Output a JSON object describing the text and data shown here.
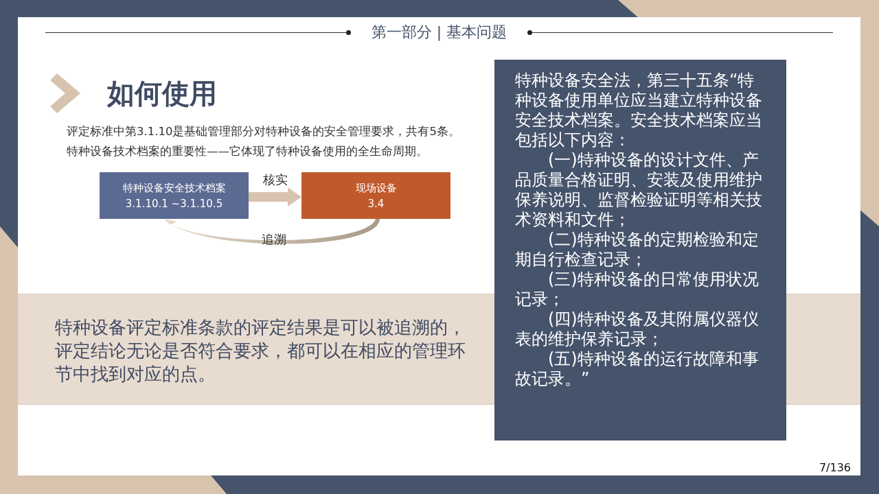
{
  "header": {
    "title": "第一部分 | 基本问题"
  },
  "heading": "如何使用",
  "intro_lines": [
    "评定标准中第3.1.10是基础管理部分对特种设备的安全管理要求，共有5条。",
    "特种设备技术档案的重要性——它体现了特种设备使用的全生命周期。"
  ],
  "diagram": {
    "source": {
      "title": "特种设备安全技术档案",
      "code": "3.1.10.1 ~3.1.10.5"
    },
    "target": {
      "title": "现场设备",
      "code": "3.4"
    },
    "forward_label": "核实",
    "back_label": "追溯"
  },
  "summary": "特种设备评定标准条款的评定结果是可以被追溯的，评定结论无论是否符合要求，都可以在相应的管理环节中找到对应的点。",
  "panel": {
    "lead": "特种设备安全法，第三十五条“特种设备使用单位应当建立特种设备安全技术档案。安全技术档案应当包括以下内容：",
    "items": [
      "(一)特种设备的设计文件、产品质量合格证明、安装及使用维护保养说明、监督检验证明等相关技术资料和文件；",
      "(二)特种设备的定期检验和定期自行检查记录；",
      "(三)特种设备的日常使用状况记录；",
      "(四)特种设备及其附属仪器仪表的维护保养记录；",
      "(五)特种设备的运行故障和事故记录。”"
    ]
  },
  "page_number": "7/136"
}
